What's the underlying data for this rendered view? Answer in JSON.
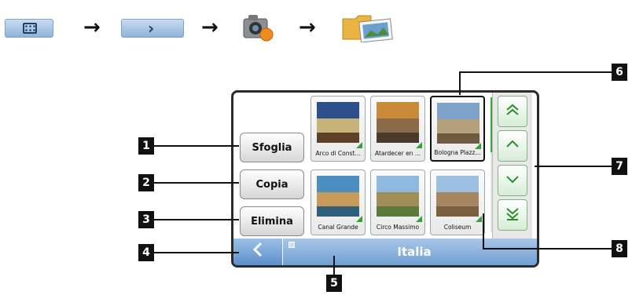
{
  "path": {
    "steps": [
      {
        "icon": "main-menu-icon"
      },
      {
        "icon": "next-arrow-icon"
      },
      {
        "icon": "camera-icon"
      },
      {
        "icon": "folder-photo-icon"
      }
    ],
    "separator_icon": "arrow-right-icon"
  },
  "sidebar": {
    "browse_label": "Sfoglia",
    "copy_label": "Copia",
    "delete_label": "Elimina"
  },
  "gallery": {
    "items": [
      {
        "caption": "Arco di Const...",
        "colors": [
          "#2d4f8a",
          "#c7b47a",
          "#5c4028"
        ]
      },
      {
        "caption": "Atardecer en ...",
        "colors": [
          "#c98a3a",
          "#8a6a48",
          "#4a3a2c"
        ]
      },
      {
        "caption": "Bologna Plazz...",
        "colors": [
          "#7fa3c8",
          "#b4a07a",
          "#6e5a40"
        ]
      },
      {
        "caption": "Canal Grande",
        "colors": [
          "#4a8fbf",
          "#c79a5a",
          "#2f5f7a"
        ]
      },
      {
        "caption": "Circo Massimo",
        "colors": [
          "#8fb8e0",
          "#a08e5a",
          "#5a7a3a"
        ]
      },
      {
        "caption": "Coliseum",
        "colors": [
          "#9cc0e0",
          "#a58660",
          "#7a6040"
        ]
      }
    ]
  },
  "scroll": {
    "top_icon": "double-chevron-up-icon",
    "up_icon": "chevron-up-icon",
    "down_icon": "chevron-down-icon",
    "bottom_icon": "double-chevron-down-icon"
  },
  "bottom_bar": {
    "back_icon": "back-chevron-icon",
    "location_label": "Italia"
  },
  "callouts": [
    "1",
    "2",
    "3",
    "4",
    "5",
    "6",
    "7",
    "8"
  ]
}
